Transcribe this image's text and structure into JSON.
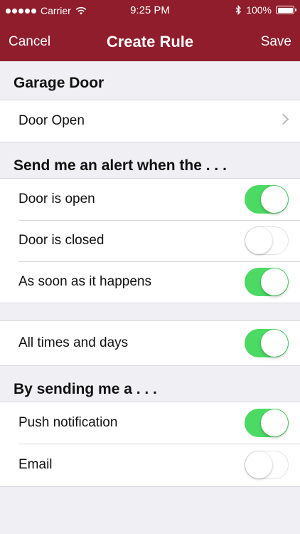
{
  "status_bar": {
    "carrier": "Carrier",
    "time": "9:25 PM",
    "battery": "100%",
    "icons": [
      "signal-dots-icon",
      "wifi-icon",
      "bluetooth-icon",
      "battery-icon"
    ]
  },
  "nav": {
    "cancel": "Cancel",
    "title": "Create Rule",
    "save": "Save"
  },
  "device": {
    "header": "Garage Door",
    "event": "Door Open"
  },
  "alert_section": {
    "header": "Send me an alert when the . . .",
    "rows": [
      {
        "label": "Door is open",
        "on": true
      },
      {
        "label": "Door is closed",
        "on": false
      },
      {
        "label": "As soon as it happens",
        "on": true
      }
    ]
  },
  "schedule": {
    "label": "All times and days",
    "on": true
  },
  "delivery_section": {
    "header": "By sending me a . . .",
    "rows": [
      {
        "label": "Push notification",
        "on": true
      },
      {
        "label": "Email",
        "on": false
      }
    ]
  },
  "colors": {
    "header_bg": "#8f1d2c",
    "toggle_on": "#4cd964",
    "background": "#efeff4"
  }
}
